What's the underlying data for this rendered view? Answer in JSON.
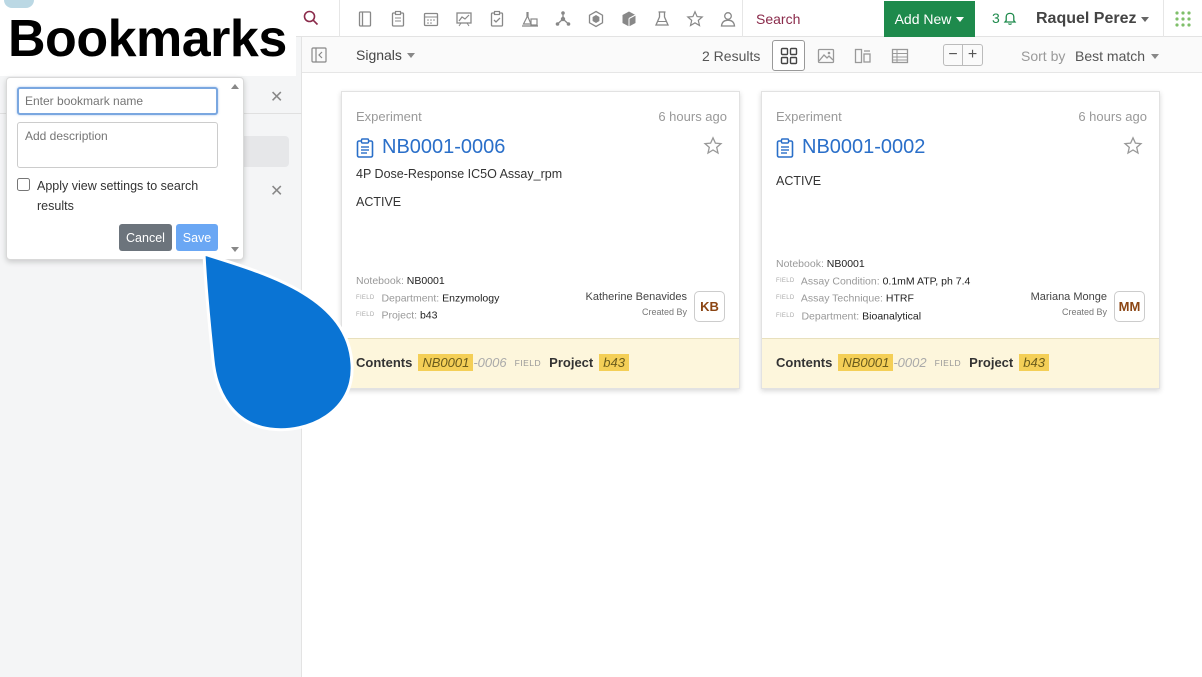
{
  "overlay_title": "Bookmarks",
  "topnav": {
    "search_label": "Search",
    "add_new_label": "Add New",
    "notification_count": "3",
    "user_name": "Raquel Perez",
    "accent_color": "#1e8a4c",
    "icons": [
      "notebook-icon",
      "clipboard-icon",
      "calendar-icon",
      "chart-icon",
      "clipboard-check-icon",
      "flask-rack-icon",
      "molecule-icon",
      "hexagon-icon",
      "cube-icon",
      "beaker-icon",
      "star-icon",
      "users-icon"
    ]
  },
  "bookmark_popup": {
    "name_placeholder": "Enter bookmark name",
    "description_placeholder": "Add description",
    "checkbox_label": "Apply view settings to search results",
    "checkbox_checked": false,
    "cancel_label": "Cancel",
    "save_label": "Save"
  },
  "toolbar": {
    "filter_label": "Signals",
    "results_text": "2 Results",
    "sort_label": "Sort by",
    "sort_value": "Best match",
    "active_view": "grid"
  },
  "cards": [
    {
      "type": "Experiment",
      "time": "6 hours ago",
      "title": "NB0001-0006",
      "subtitle": "4P Dose-Response IC5O Assay_rpm",
      "status": "ACTIVE",
      "fields": [
        {
          "tag": "",
          "label": "Notebook:",
          "value": "NB0001"
        },
        {
          "tag": "FIELD",
          "label": "Department:",
          "value": "Enzymology"
        },
        {
          "tag": "FIELD",
          "label": "Project:",
          "value": "b43"
        }
      ],
      "creator_name": "Katherine Benavides",
      "created_by_label": "Created By",
      "initials": "KB",
      "footer": {
        "contents_label": "Contents",
        "hl1": "NB0001",
        "suffix": "-0006",
        "field_tag": "FIELD",
        "project_label": "Project",
        "hl2": "b43"
      }
    },
    {
      "type": "Experiment",
      "time": "6 hours ago",
      "title": "NB0001-0002",
      "subtitle": "",
      "status": "ACTIVE",
      "fields": [
        {
          "tag": "",
          "label": "Notebook:",
          "value": "NB0001"
        },
        {
          "tag": "FIELD",
          "label": "Assay Condition:",
          "value": "0.1mM ATP, ph 7.4"
        },
        {
          "tag": "FIELD",
          "label": "Assay Technique:",
          "value": "HTRF"
        },
        {
          "tag": "FIELD",
          "label": "Department:",
          "value": "Bioanalytical"
        }
      ],
      "creator_name": "Mariana Monge",
      "created_by_label": "Created By",
      "initials": "MM",
      "footer": {
        "contents_label": "Contents",
        "hl1": "NB0001",
        "suffix": "-0002",
        "field_tag": "FIELD",
        "project_label": "Project",
        "hl2": "b43"
      }
    }
  ]
}
